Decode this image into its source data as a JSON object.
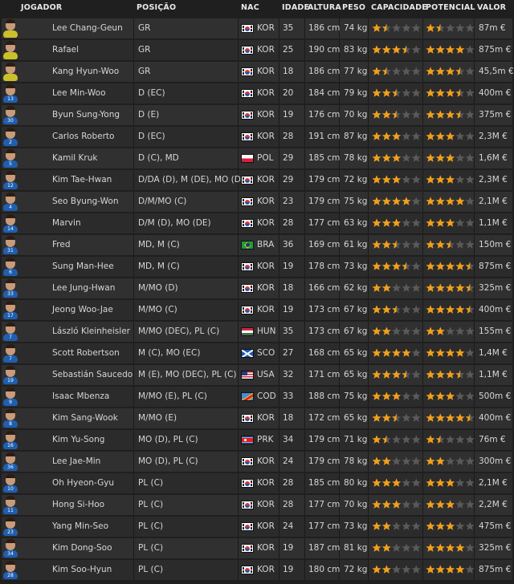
{
  "columns": {
    "player": "JOGADOR",
    "position": "POSIÇÃO",
    "nation": "NAC",
    "age": "IDADE",
    "height": "ALTURA",
    "weight": "PESO",
    "ability": "CAPACIDADE",
    "potential": "POTENCIAL",
    "value": "VALOR"
  },
  "colors": {
    "star_full": "#f2a019",
    "star_empty": "#5a5a5a"
  },
  "players": [
    {
      "name": "Lee Chang-Geun",
      "pos": "GR",
      "nat": "KOR",
      "age": "35",
      "height": "186 cm",
      "weight": "74 kg",
      "ability": 1.5,
      "potential": 1.5,
      "value": "87m €",
      "kit": "gk",
      "num": ""
    },
    {
      "name": "Rafael",
      "pos": "GR",
      "nat": "KOR",
      "age": "25",
      "height": "190 cm",
      "weight": "83 kg",
      "ability": 3.5,
      "potential": 4,
      "value": "875m €",
      "kit": "gk",
      "num": ""
    },
    {
      "name": "Kang Hyun-Woo",
      "pos": "GR",
      "nat": "KOR",
      "age": "18",
      "height": "186 cm",
      "weight": "77 kg",
      "ability": 1.5,
      "potential": 3.5,
      "value": "45,5m €",
      "kit": "gk",
      "num": ""
    },
    {
      "name": "Lee Min-Woo",
      "pos": "D (EC)",
      "nat": "KOR",
      "age": "20",
      "height": "184 cm",
      "weight": "79 kg",
      "ability": 2.5,
      "potential": 3.5,
      "value": "400m €",
      "kit": "out",
      "num": "13"
    },
    {
      "name": "Byun Sung-Yong",
      "pos": "D (E)",
      "nat": "KOR",
      "age": "19",
      "height": "176 cm",
      "weight": "70 kg",
      "ability": 2.5,
      "potential": 3.5,
      "value": "375m €",
      "kit": "out",
      "num": "30"
    },
    {
      "name": "Carlos Roberto",
      "pos": "D (EC)",
      "nat": "KOR",
      "age": "28",
      "height": "191 cm",
      "weight": "87 kg",
      "ability": 3,
      "potential": 3,
      "value": "2,3M €",
      "kit": "out",
      "num": "2"
    },
    {
      "name": "Kamil Kruk",
      "pos": "D (C), MD",
      "nat": "POL",
      "age": "29",
      "height": "185 cm",
      "weight": "78 kg",
      "ability": 3,
      "potential": 3,
      "value": "1,6M €",
      "kit": "out",
      "num": "5"
    },
    {
      "name": "Kim Tae-Hwan",
      "pos": "D/DA (D), M (DE), MO (D)",
      "nat": "KOR",
      "age": "29",
      "height": "179 cm",
      "weight": "72 kg",
      "ability": 3,
      "potential": 3,
      "value": "2,3M €",
      "kit": "out",
      "num": "12"
    },
    {
      "name": "Seo Byung-Won",
      "pos": "D/M/MO (C)",
      "nat": "KOR",
      "age": "23",
      "height": "179 cm",
      "weight": "75 kg",
      "ability": 4,
      "potential": 4,
      "value": "2,1M €",
      "kit": "out",
      "num": "4"
    },
    {
      "name": "Marvin",
      "pos": "D/M (D), MO (DE)",
      "nat": "KOR",
      "age": "28",
      "height": "177 cm",
      "weight": "63 kg",
      "ability": 3,
      "potential": 3,
      "value": "1,1M €",
      "kit": "out",
      "num": "14"
    },
    {
      "name": "Fred",
      "pos": "MD, M (C)",
      "nat": "BRA",
      "age": "36",
      "height": "169 cm",
      "weight": "61 kg",
      "ability": 2.5,
      "potential": 2.5,
      "value": "150m €",
      "kit": "out",
      "num": "31"
    },
    {
      "name": "Sung Man-Hee",
      "pos": "MD, M (C)",
      "nat": "KOR",
      "age": "19",
      "height": "178 cm",
      "weight": "73 kg",
      "ability": 3.5,
      "potential": 4.5,
      "value": "875m €",
      "kit": "out",
      "num": "6"
    },
    {
      "name": "Lee Jung-Hwan",
      "pos": "M/MO (D)",
      "nat": "KOR",
      "age": "18",
      "height": "166 cm",
      "weight": "62 kg",
      "ability": 2,
      "potential": 4.5,
      "value": "325m €",
      "kit": "out",
      "num": "33"
    },
    {
      "name": "Jeong Woo-Jae",
      "pos": "M/MO (C)",
      "nat": "KOR",
      "age": "19",
      "height": "173 cm",
      "weight": "67 kg",
      "ability": 2.5,
      "potential": 4.5,
      "value": "400m €",
      "kit": "out",
      "num": "17"
    },
    {
      "name": "László Kleinheisler",
      "pos": "M/MO (DEC), PL (C)",
      "nat": "HUN",
      "age": "35",
      "height": "173 cm",
      "weight": "67 kg",
      "ability": 2,
      "potential": 2,
      "value": "155m €",
      "kit": "out",
      "num": "7"
    },
    {
      "name": "Scott Robertson",
      "pos": "M (C), MO (EC)",
      "nat": "SCO",
      "age": "27",
      "height": "168 cm",
      "weight": "65 kg",
      "ability": 4,
      "potential": 4,
      "value": "1,4M €",
      "kit": "out",
      "num": "7"
    },
    {
      "name": "Sebastián Saucedo",
      "pos": "M (E), MO (DEC), PL (C)",
      "nat": "USA",
      "age": "32",
      "height": "171 cm",
      "weight": "65 kg",
      "ability": 3.5,
      "potential": 3.5,
      "value": "1,1M €",
      "kit": "out",
      "num": "19"
    },
    {
      "name": "Isaac Mbenza",
      "pos": "M/MO (E), PL (C)",
      "nat": "COD",
      "age": "33",
      "height": "188 cm",
      "weight": "75 kg",
      "ability": 3,
      "potential": 3,
      "value": "500m €",
      "kit": "out",
      "num": "9"
    },
    {
      "name": "Kim Sang-Wook",
      "pos": "M/MO (E)",
      "nat": "KOR",
      "age": "18",
      "height": "172 cm",
      "weight": "65 kg",
      "ability": 2.5,
      "potential": 4.5,
      "value": "400m €",
      "kit": "out",
      "num": "8"
    },
    {
      "name": "Kim Yu-Song",
      "pos": "MO (D), PL (C)",
      "nat": "PRK",
      "age": "34",
      "height": "179 cm",
      "weight": "71 kg",
      "ability": 1.5,
      "potential": 1.5,
      "value": "76m €",
      "kit": "out",
      "num": "16"
    },
    {
      "name": "Lee Jae-Min",
      "pos": "MO (D), PL (C)",
      "nat": "KOR",
      "age": "24",
      "height": "179 cm",
      "weight": "78 kg",
      "ability": 2,
      "potential": 2,
      "value": "300m €",
      "kit": "out",
      "num": "36"
    },
    {
      "name": "Oh Hyeon-Gyu",
      "pos": "PL (C)",
      "nat": "KOR",
      "age": "28",
      "height": "185 cm",
      "weight": "80 kg",
      "ability": 3,
      "potential": 3,
      "value": "2,1M €",
      "kit": "out",
      "num": "10"
    },
    {
      "name": "Hong Si-Hoo",
      "pos": "PL (C)",
      "nat": "KOR",
      "age": "28",
      "height": "177 cm",
      "weight": "70 kg",
      "ability": 3,
      "potential": 3,
      "value": "2,2M €",
      "kit": "out",
      "num": "11"
    },
    {
      "name": "Yang Min-Seo",
      "pos": "PL (C)",
      "nat": "KOR",
      "age": "24",
      "height": "177 cm",
      "weight": "73 kg",
      "ability": 2,
      "potential": 3,
      "value": "475m €",
      "kit": "out",
      "num": "23"
    },
    {
      "name": "Kim Dong-Soo",
      "pos": "PL (C)",
      "nat": "KOR",
      "age": "19",
      "height": "187 cm",
      "weight": "81 kg",
      "ability": 2,
      "potential": 4,
      "value": "325m €",
      "kit": "out",
      "num": "34"
    },
    {
      "name": "Kim Soo-Hyun",
      "pos": "PL (C)",
      "nat": "KOR",
      "age": "19",
      "height": "180 cm",
      "weight": "72 kg",
      "ability": 2,
      "potential": 4,
      "value": "875m €",
      "kit": "out",
      "num": "28"
    }
  ]
}
